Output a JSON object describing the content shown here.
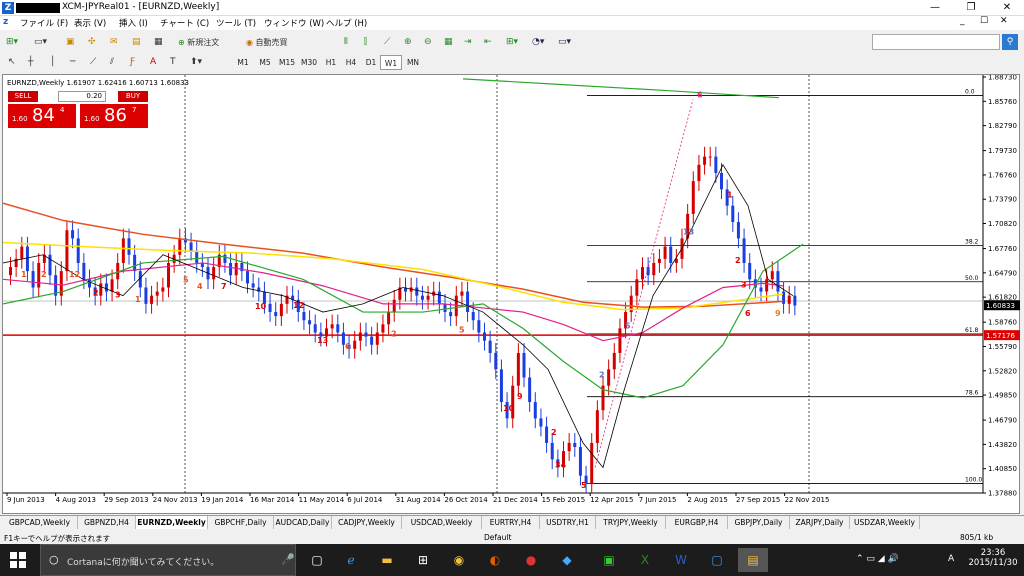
{
  "window": {
    "title": "XCM-JPYReal01 - [EURNZD,Weekly]",
    "logo": "Z",
    "min": "—",
    "max": "❐",
    "close": "✕"
  },
  "menu": {
    "items": [
      "ファイル (F)",
      "表示 (V)",
      "挿入 (I)",
      "チャート (C)",
      "ツール (T)",
      "ウィンドウ (W)",
      "ヘルプ (H)"
    ],
    "controls": [
      "_",
      "☐",
      "✕"
    ]
  },
  "toolbar": {
    "new_order": "新規注文",
    "auto_trade": "自動売買",
    "timeframes": [
      "M1",
      "M5",
      "M15",
      "M30",
      "H1",
      "H4",
      "D1",
      "W1",
      "MN"
    ],
    "selected_timeframe": "W1"
  },
  "chart": {
    "header": "EURNZD,Weekly  1.61907 1.62416 1.60713 1.60833",
    "sell_label": "SELL",
    "buy_label": "BUY",
    "lot": "0.20",
    "sell_price": {
      "prefix": "1.60",
      "big": "84",
      "sup": "4"
    },
    "buy_price": {
      "prefix": "1.60",
      "big": "86",
      "sup": "7"
    },
    "price_labels": [
      "1.88730",
      "1.85760",
      "1.82790",
      "1.79730",
      "1.76760",
      "1.73790",
      "1.70820",
      "1.67760",
      "1.64790",
      "1.61820",
      "1.58760",
      "1.55790",
      "1.52820",
      "1.49850",
      "1.46790",
      "1.43820",
      "1.40850",
      "1.37880"
    ],
    "current_price_label": "1.60833",
    "red_line_label": "1.57176",
    "date_labels": [
      "9 Jun 2013",
      "4 Aug 2013",
      "29 Sep 2013",
      "24 Nov 2013",
      "19 Jan 2014",
      "16 Mar 2014",
      "11 May 2014",
      "6 Jul 2014",
      "31 Aug 2014",
      "26 Oct 2014",
      "21 Dec 2014",
      "15 Feb 2015",
      "12 Apr 2015",
      "7 Jun 2015",
      "2 Aug 2015",
      "27 Sep 2015",
      "22 Nov 2015"
    ],
    "fib_labels": [
      "0.0",
      "38.2",
      "50.0",
      "61.8",
      "78.6",
      "100.0"
    ]
  },
  "chart_data": {
    "type": "candlestick",
    "symbol": "EURNZD",
    "timeframe": "Weekly",
    "ylim": [
      1.3788,
      1.8873
    ],
    "ohlc_last": {
      "open": 1.61907,
      "high": 1.62416,
      "low": 1.60713,
      "close": 1.60833
    },
    "current_price": 1.60833,
    "horizontal_line": 1.57176,
    "fibonacci_levels": [
      0.0,
      38.2,
      50.0,
      61.8,
      78.6,
      100.0
    ]
  },
  "tabs": [
    "GBPCAD,Weekly",
    "GBPNZD,H4",
    "EURNZD,Weekly",
    "GBPCHF,Daily",
    "AUDCAD,Daily",
    "CADJPY,Weekly",
    "USDCAD,Weekly",
    "EURTRY,H4",
    "USDTRY,H1",
    "TRYJPY,Weekly",
    "EURGBP,H4",
    "GBPJPY,Daily",
    "ZARJPY,Daily",
    "USDZAR,Weekly"
  ],
  "active_tab": "EURNZD,Weekly",
  "status": {
    "help": "F1キーでヘルプが表示されます",
    "profile": "Default",
    "traffic": "805/1 kb"
  },
  "taskbar": {
    "cortana": "Cortanaに何か聞いてみてください。",
    "time": "23:36",
    "date": "2015/11/30",
    "ime": "A"
  }
}
